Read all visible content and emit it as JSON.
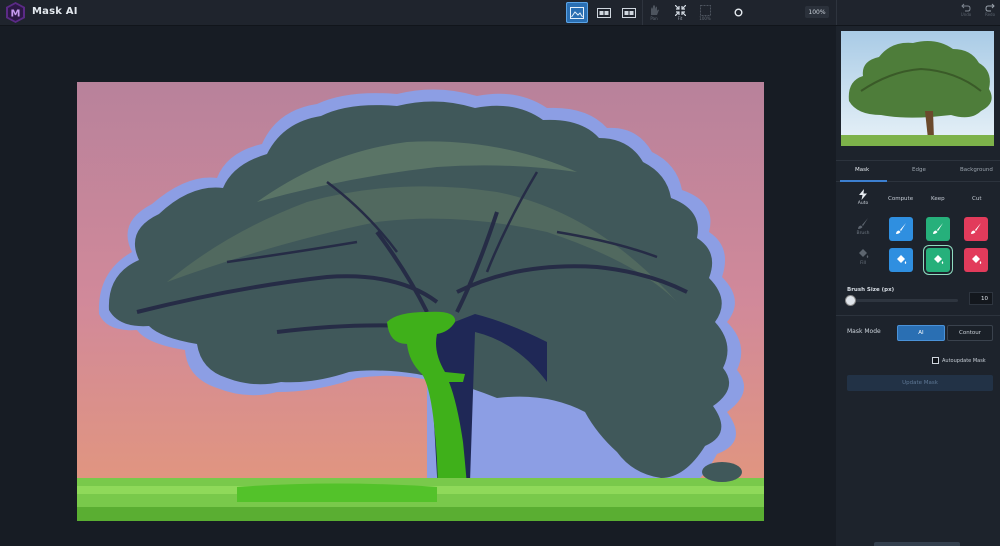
{
  "app": {
    "title": "Mask AI",
    "zoom": "100%"
  },
  "toolbar": {
    "tools": [
      {
        "name": "view-mask",
        "label": "",
        "active": true
      },
      {
        "name": "view-split",
        "label": "",
        "active": false
      },
      {
        "name": "view-side-by-side",
        "label": "",
        "active": false
      },
      {
        "name": "pan",
        "label": "Pan",
        "active": false
      },
      {
        "name": "fit",
        "label": "Fit",
        "active": false
      },
      {
        "name": "100pct",
        "label": "100%",
        "active": false
      }
    ],
    "undo_label": "Undo",
    "redo_label": "Redo"
  },
  "panel": {
    "tabs": [
      "Mask",
      "Edge",
      "Background"
    ],
    "active_tab": "Mask",
    "columns": [
      "Compute",
      "Keep",
      "Cut"
    ],
    "side_tools": {
      "auto": "Auto",
      "brush": "Brush",
      "fill": "Fill"
    },
    "brush_size_label": "Brush Size (px)",
    "brush_size_value": "10",
    "brush_size_fraction": 0.02,
    "mask_mode_label": "Mask Mode",
    "mask_modes": [
      "AI",
      "Contour"
    ],
    "active_mask_mode": "AI",
    "autoupdate_label": "Autoupdate Mask",
    "autoupdate_checked": false,
    "update_label": "Update Mask"
  },
  "colors": {
    "accent": "#2a6fb3",
    "compute": "#2f8fe0",
    "keep": "#26b07b",
    "cut": "#e23b5b"
  }
}
